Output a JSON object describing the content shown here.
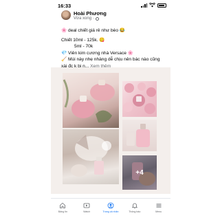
{
  "status_bar": {
    "time": "16:33"
  },
  "post": {
    "author": "Hoài Phương",
    "meta": "Vừa xong ·",
    "lines": [
      {
        "prefix": "🌸",
        "text": " deal chiết giá rẻ như bèo 😂"
      },
      {
        "prefix": "",
        "text": "Chiết 10ml - 125k. 😋"
      },
      {
        "prefix": "",
        "text": "5ml - 70k"
      },
      {
        "prefix": "💎",
        "text": " Viên kim cương nhà Versace 🌸"
      },
      {
        "prefix": "🧹",
        "text": " Mùi này nhẹ nhàng dễ chịu nên bác nào cũng"
      },
      {
        "prefix": "",
        "text": "xài đc k bị n... "
      }
    ],
    "see_more": "Xem thêm",
    "more_photos": "+4"
  },
  "tabs": [
    {
      "label": "Bảng tin",
      "icon": "home-icon",
      "active": false
    },
    {
      "label": "Watch",
      "icon": "video-icon",
      "active": false
    },
    {
      "label": "Trang cá nhân",
      "icon": "profile-icon",
      "active": true
    },
    {
      "label": "Thông báo",
      "icon": "bell-icon",
      "active": false
    },
    {
      "label": "Menu",
      "icon": "menu-icon",
      "active": false
    }
  ],
  "colors": {
    "accent": "#1877f2",
    "muted": "#65676b",
    "text": "#050505"
  }
}
